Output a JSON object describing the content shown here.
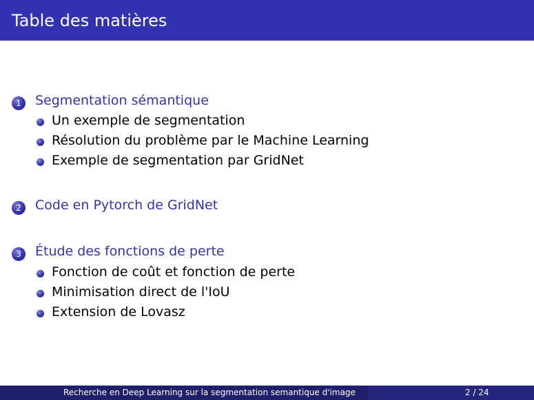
{
  "header": {
    "title": "Table des matières"
  },
  "sections": [
    {
      "number": "1",
      "title": "Segmentation sémantique",
      "items": [
        "Un exemple de segmentation",
        "Résolution du problème par le Machine Learning",
        "Exemple de segmentation par GridNet"
      ]
    },
    {
      "number": "2",
      "title": "Code en Pytorch de GridNet",
      "items": []
    },
    {
      "number": "3",
      "title": "Étude des fonctions de perte",
      "items": [
        "Fonction de coût et fonction de perte",
        "Minimisation direct de l'IoU",
        "Extension de Lovasz"
      ]
    }
  ],
  "footer": {
    "title": "Recherche en Deep Learning sur la segmentation semantique d'image",
    "page": "2 / 24"
  },
  "colors": {
    "header_bg": "#3333b2",
    "accent": "#3333b2",
    "footer_left": "#1f1f6b",
    "footer_right": "#26267f"
  }
}
